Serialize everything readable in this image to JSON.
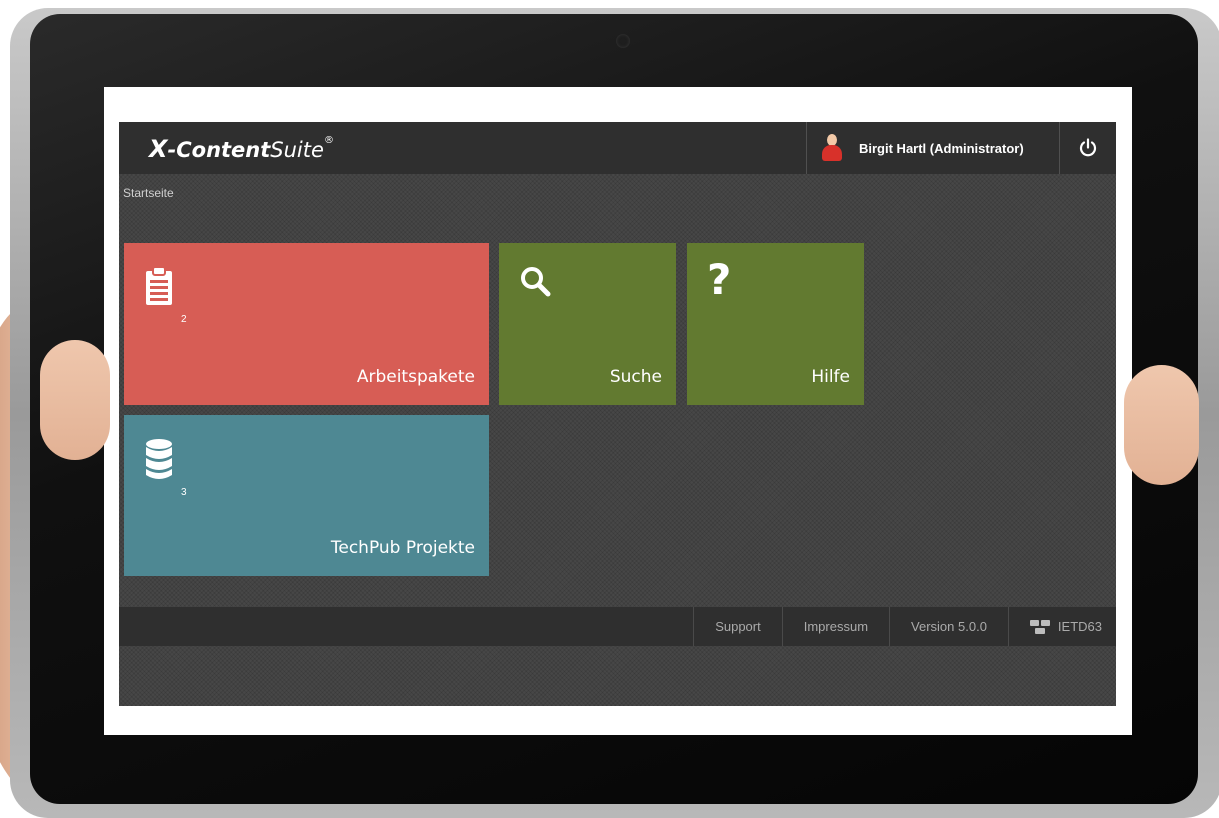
{
  "app": {
    "logo": {
      "x": "X",
      "content": "-Content",
      "suite": "Suite",
      "reg": "®"
    },
    "user": {
      "name": "Birgit Hartl (Administrator)",
      "icon": "user-avatar-icon"
    },
    "power_icon": "power-icon"
  },
  "breadcrumb": "Startseite",
  "tiles": [
    {
      "label": "Arbeitspakete",
      "icon": "clipboard-icon",
      "badge": "2",
      "color": "#d75d55"
    },
    {
      "label": "Suche",
      "icon": "search-icon",
      "color": "#627a30"
    },
    {
      "label": "Hilfe",
      "icon": "help-icon",
      "glyph": "?",
      "color": "#627a30"
    },
    {
      "label": "TechPub Projekte",
      "icon": "database-icon",
      "badge": "3",
      "color": "#4e8893"
    }
  ],
  "footer": {
    "support": "Support",
    "impressum": "Impressum",
    "version": "Version 5.0.0",
    "server": "IETD63",
    "server_icon": "server-icon"
  }
}
